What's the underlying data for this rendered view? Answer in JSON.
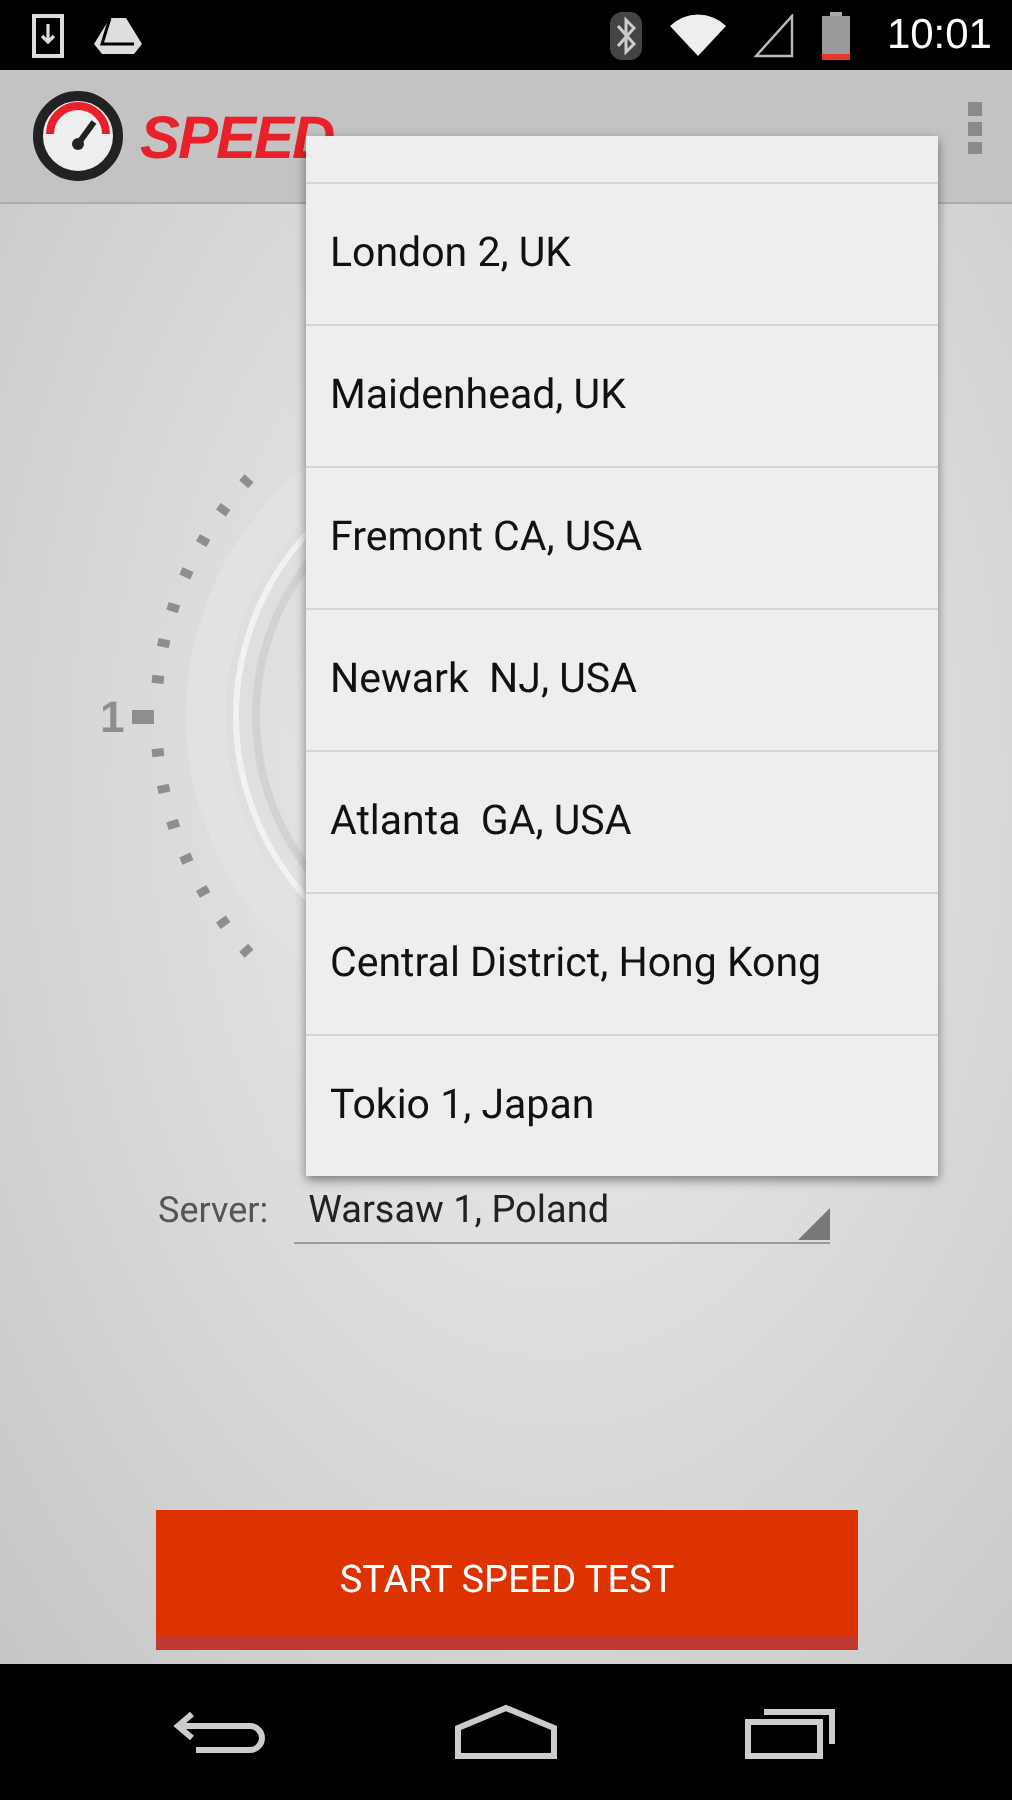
{
  "status_bar": {
    "time": "10:01"
  },
  "app_bar": {
    "logo_first": "SPEED"
  },
  "gauge": {
    "labels": [
      "1"
    ]
  },
  "dropdown": {
    "items": [
      {
        "label": "London 2, UK"
      },
      {
        "label": "Maidenhead, UK"
      },
      {
        "label": "Fremont CA, USA"
      },
      {
        "label": "Newark  NJ, USA"
      },
      {
        "label": "Atlanta  GA, USA"
      },
      {
        "label": "Central District, Hong Kong"
      },
      {
        "label": "Tokio 1, Japan"
      }
    ]
  },
  "server": {
    "label": "Server:",
    "value": "Warsaw 1, Poland"
  },
  "start_button": {
    "label": "START SPEED TEST"
  }
}
